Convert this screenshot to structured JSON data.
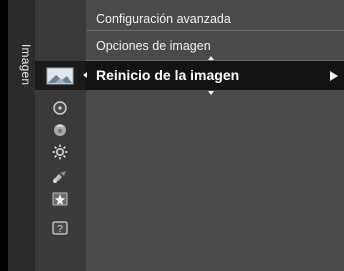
{
  "sidebar": {
    "tab_label": "Imagen",
    "icons": [
      {
        "name": "picture-icon"
      },
      {
        "name": "sound-icon"
      },
      {
        "name": "channel-icon"
      },
      {
        "name": "setup-icon"
      },
      {
        "name": "input-icon"
      },
      {
        "name": "application-icon"
      },
      {
        "name": "support-icon"
      }
    ]
  },
  "menu": {
    "items": [
      {
        "label": "Configuración avanzada",
        "active": false
      },
      {
        "label": "Opciones de imagen",
        "active": false
      },
      {
        "label": "Reinicio de la imagen",
        "active": true
      }
    ]
  },
  "colors": {
    "background": "#4a4a4a",
    "highlight": "#131313",
    "text": "#f1f1f1"
  }
}
